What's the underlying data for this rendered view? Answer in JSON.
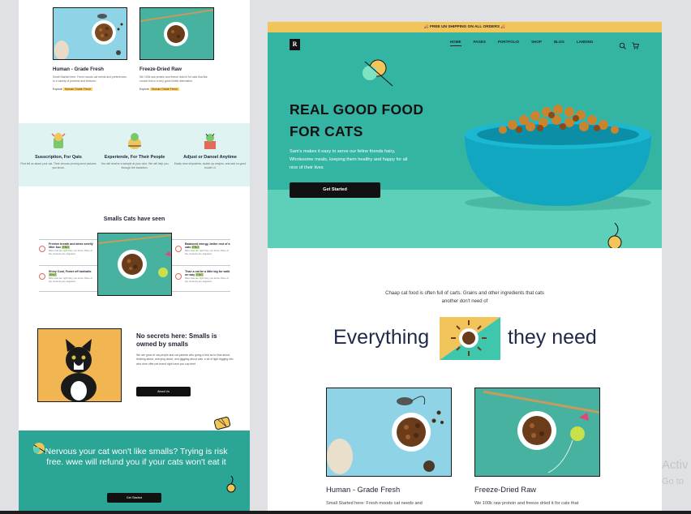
{
  "left": {
    "products": [
      {
        "title": "Human - Grade Fresh",
        "desc": "Small Started here: Fresh moods cat needs and preferences, to a variety of proteins and textures.",
        "explore_prefix": "Explore",
        "explore_link": "Human Grade Fresh"
      },
      {
        "title": "Freeze-Dried Raw",
        "desc": "We 100k raw protein and freeze dried it for cats that like crunch this is a very good kibble alternative.",
        "explore_prefix": "Explore",
        "explore_link": "Human Grade Fresh"
      }
    ],
    "features": [
      {
        "title": "Susscription, For Qats",
        "desc": "First tell us about your cat. Their choose proving send pictures you know."
      },
      {
        "title": "Experiende, For Their People",
        "desc": "You will receive a sample at your door. We will help you through the transition."
      },
      {
        "title": "Adjust or Danoel Anytime",
        "desc": "Easily view shipments, switch up recipes, and add on good boost! Lit"
      }
    ],
    "seen": {
      "title": "Smalls Cats have seen",
      "items": [
        {
          "title": "Fresher breath and aless smelly litter box",
          "tag": "ENO",
          "desc": "Miss cats are right they you know. More of the nutrients are digestive."
        },
        {
          "title": "Balanced energy, better rest of a cats",
          "tag": "ENO",
          "desc": "Miss cats are right they you know. More of the nutrients are digestive."
        },
        {
          "title": "Shiny Coat, Fewer off hairballs",
          "tag": "ENO",
          "desc": "Miss cats are right they you know. More of the nutrients are digestive."
        },
        {
          "title": "Than a cat be a little big for walk on way",
          "tag": "ENO",
          "desc": "Miss cats are right they you know. More of the nutrients are digestive."
        }
      ]
    },
    "secret": {
      "title": "No secrets here: Smalls is owned by smalls",
      "desc": "We are good of cat people and cat parents who going a bird as to time about, thinking about, worrying about, and giggling about cats. a lot of light digging into who dore offer pet brand right have you cup tried",
      "button": "About Us"
    },
    "bottom": {
      "heading": "Nervous your cat won't like smalls? Trying is risk free. wwe will refund you if your cats won't eat it",
      "button": "Get Started"
    }
  },
  "right": {
    "promo": "FREE UN SHIPPING ON ALL ORDERS",
    "logo": "R",
    "nav": [
      "HOME",
      "PAGES",
      "PORTFOLIO",
      "SHOP",
      "BLOG",
      "LANDING"
    ],
    "hero": {
      "title_line1": "REAL GOOD FOOD",
      "title_line2": "FOR CATS",
      "desc": "Sam's makes it easy to serve our feline friends hairy, Wholesome meals, keeping them healthy and happy for all nice of their lives",
      "button": "Get Started"
    },
    "intro": "Chaap cat food is often full of carts. Grains and other ingredients that cats another don't need of",
    "everything_left": "Everything",
    "everything_right": "they need",
    "products": [
      {
        "title": "Human - Grade Fresh",
        "desc": "Small Started here: Fresh moods cat needs and"
      },
      {
        "title": "Freeze-Dried Raw",
        "desc": "We 100k raw protein and freeze dried it for cats that"
      }
    ]
  },
  "watermark": {
    "line1": "Activ",
    "line2": "Go to"
  },
  "colors": {
    "teal": "#34b5a4",
    "mint": "#5ecfb9",
    "yellow": "#f2c55a",
    "dark": "#111111"
  }
}
